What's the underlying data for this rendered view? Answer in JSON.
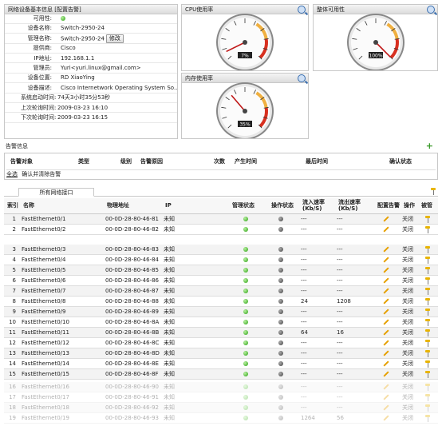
{
  "info": {
    "title": "网络设备基本信息",
    "config_link": "[配置告警]",
    "rows": [
      {
        "label": "可用性:",
        "value": ""
      },
      {
        "label": "设备名称:",
        "value": "Switch-2950-24"
      },
      {
        "label": "管理名称:",
        "value": "Switch-2950-24",
        "button": "修改"
      },
      {
        "label": "提供商:",
        "value": "Cisco"
      },
      {
        "label": "IP地址:",
        "value": "192.168.1.1"
      },
      {
        "label": "管理员:",
        "value": "Yuri<yuri.linux@gmail.com>"
      },
      {
        "label": "设备位置:",
        "value": "RD XiaoYing"
      },
      {
        "label": "设备描述:",
        "value": "Cisco Internetwork Operating System So..."
      },
      {
        "label": "系统启动时间:",
        "value": "74天3小时35分53秒"
      },
      {
        "label": "上次轮询时间:",
        "value": "2009-03-23 16:10"
      },
      {
        "label": "下次轮询时间:",
        "value": "2009-03-23 16:15"
      }
    ]
  },
  "gauges": {
    "cpu": {
      "title": "CPU使用率",
      "value": "7%",
      "level": 0.07
    },
    "overall": {
      "title": "整体可用性",
      "value": "100%",
      "level": 1.0
    },
    "memory": {
      "title": "内存使用率",
      "value": "35%",
      "level": 0.35
    }
  },
  "alerts": {
    "title": "告警信息",
    "columns": [
      "告警对象",
      "类型",
      "级别",
      "告警原因",
      "次数",
      "产生时间",
      "最后时间",
      "确认状态"
    ],
    "select_all": "全选",
    "confirm": "确认并清除告警"
  },
  "interfaces": {
    "tab": "所有网络接口",
    "columns": [
      "索引",
      "名称",
      "物理地址",
      "IP",
      "管理状态",
      "操作状态",
      "流入速率(Kb/S)",
      "流出速率(Kb/S)",
      "配置告警",
      "操作",
      "被管"
    ],
    "rows_top": [
      {
        "idx": "1",
        "name": "FastEthernet0/1",
        "mac": "00-0D-28-80-46-81",
        "ip": "未知",
        "in": "---",
        "out": "---",
        "op": "关闭"
      },
      {
        "idx": "2",
        "name": "FastEthernet0/2",
        "mac": "00-0D-28-80-46-82",
        "ip": "未知",
        "in": "---",
        "out": "---",
        "op": "关闭"
      }
    ],
    "rows": [
      {
        "idx": "3",
        "name": "FastEthernet0/3",
        "mac": "00-0D-28-80-46-83",
        "ip": "未知",
        "in": "---",
        "out": "---",
        "op": "关闭"
      },
      {
        "idx": "4",
        "name": "FastEthernet0/4",
        "mac": "00-0D-28-80-46-84",
        "ip": "未知",
        "in": "---",
        "out": "---",
        "op": "关闭"
      },
      {
        "idx": "5",
        "name": "FastEthernet0/5",
        "mac": "00-0D-28-80-46-85",
        "ip": "未知",
        "in": "---",
        "out": "---",
        "op": "关闭"
      },
      {
        "idx": "6",
        "name": "FastEthernet0/6",
        "mac": "00-0D-28-80-46-86",
        "ip": "未知",
        "in": "---",
        "out": "---",
        "op": "关闭"
      },
      {
        "idx": "7",
        "name": "FastEthernet0/7",
        "mac": "00-0D-28-80-46-87",
        "ip": "未知",
        "in": "---",
        "out": "---",
        "op": "关闭"
      },
      {
        "idx": "8",
        "name": "FastEthernet0/8",
        "mac": "00-0D-28-80-46-88",
        "ip": "未知",
        "in": "24",
        "out": "1208",
        "op": "关闭"
      },
      {
        "idx": "9",
        "name": "FastEthernet0/9",
        "mac": "00-0D-28-80-46-89",
        "ip": "未知",
        "in": "---",
        "out": "---",
        "op": "关闭"
      },
      {
        "idx": "10",
        "name": "FastEthernet0/10",
        "mac": "00-0D-28-80-46-8A",
        "ip": "未知",
        "in": "---",
        "out": "---",
        "op": "关闭"
      },
      {
        "idx": "11",
        "name": "FastEthernet0/11",
        "mac": "00-0D-28-80-46-8B",
        "ip": "未知",
        "in": "64",
        "out": "16",
        "op": "关闭"
      },
      {
        "idx": "12",
        "name": "FastEthernet0/12",
        "mac": "00-0D-28-80-46-8C",
        "ip": "未知",
        "in": "---",
        "out": "---",
        "op": "关闭"
      },
      {
        "idx": "13",
        "name": "FastEthernet0/13",
        "mac": "00-0D-28-80-46-8D",
        "ip": "未知",
        "in": "---",
        "out": "---",
        "op": "关闭"
      },
      {
        "idx": "14",
        "name": "FastEthernet0/14",
        "mac": "00-0D-28-80-46-8E",
        "ip": "未知",
        "in": "---",
        "out": "---",
        "op": "关闭"
      },
      {
        "idx": "15",
        "name": "FastEthernet0/15",
        "mac": "00-0D-28-80-46-8F",
        "ip": "未知",
        "in": "---",
        "out": "---",
        "op": "关闭"
      }
    ],
    "rows_faded": [
      {
        "idx": "16",
        "name": "FastEthernet0/16",
        "mac": "00-0D-28-80-46-90",
        "ip": "未知",
        "in": "---",
        "out": "---",
        "op": "关闭"
      },
      {
        "idx": "17",
        "name": "FastEthernet0/17",
        "mac": "00-0D-28-80-46-91",
        "ip": "未知",
        "in": "---",
        "out": "---",
        "op": "关闭"
      },
      {
        "idx": "18",
        "name": "FastEthernet0/18",
        "mac": "00-0D-28-80-46-92",
        "ip": "未知",
        "in": "---",
        "out": "---",
        "op": "关闭"
      },
      {
        "idx": "19",
        "name": "FastEthernet0/19",
        "mac": "00-0D-28-80-46-93",
        "ip": "未知",
        "in": "1264",
        "out": "56",
        "op": "关闭"
      }
    ]
  },
  "colors": {
    "status_green": "#28a010",
    "status_dark": "#444444",
    "pin": "#e8b400",
    "pencil": "#e6a000"
  }
}
